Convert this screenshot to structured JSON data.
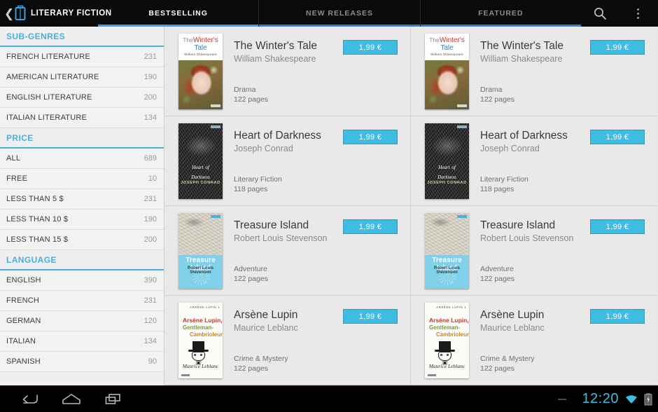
{
  "actionbar": {
    "back_icon": "back-chevron-icon",
    "app_icon": "book-reader-icon",
    "app_title": "LITERARY FICTION",
    "search_icon": "search-icon",
    "overflow_icon": "overflow-menu-icon",
    "tabs": [
      {
        "label": "BESTSELLING",
        "active": true
      },
      {
        "label": "NEW RELEASES",
        "active": false
      },
      {
        "label": "FEATURED",
        "active": false
      }
    ]
  },
  "sidebar": {
    "sections": [
      {
        "heading": "SUB-GENRES",
        "items": [
          {
            "label": "FRENCH LITERATURE",
            "count": "231"
          },
          {
            "label": "AMERICAN LITERATURE",
            "count": "190"
          },
          {
            "label": "ENGLISH LITERATURE",
            "count": "200"
          },
          {
            "label": "ITALIAN LITERATURE",
            "count": "134"
          }
        ]
      },
      {
        "heading": "PRICE",
        "items": [
          {
            "label": "ALL",
            "count": "689"
          },
          {
            "label": "FREE",
            "count": "10"
          },
          {
            "label": "LESS THAN 5 $",
            "count": "231"
          },
          {
            "label": "LESS THAN 10 $",
            "count": "190"
          },
          {
            "label": "LESS THAN 15 $",
            "count": "200"
          }
        ]
      },
      {
        "heading": "LANGUAGE",
        "items": [
          {
            "label": "ENGLISH",
            "count": "390"
          },
          {
            "label": "FRENCH",
            "count": "231"
          },
          {
            "label": "GERMAN",
            "count": "120"
          },
          {
            "label": "ITALIAN",
            "count": "134"
          },
          {
            "label": "SPANISH",
            "count": "90"
          }
        ]
      }
    ]
  },
  "books": [
    {
      "title": "The Winter's Tale",
      "author": "William Shakespeare",
      "genre": "Drama",
      "pages": "122 pages",
      "price": "1,99 €",
      "cover": "winters-tale",
      "cover_text": {
        "the": "The",
        "winters": "Winter's",
        "tale": "Tale",
        "author": "William Shakespeare"
      }
    },
    {
      "title": "Heart of Darkness",
      "author": "Joseph Conrad",
      "genre": "Literary Fiction",
      "pages": "118 pages",
      "price": "1,99 €",
      "cover": "heart-of-darkness",
      "cover_text": {
        "line1": "Heart",
        "of": "of",
        "line2": "Darkness",
        "author": "JOSEPH CONRAD"
      }
    },
    {
      "title": "Treasure Island",
      "author": "Robert Louis Stevenson",
      "genre": "Adventure",
      "pages": "122 pages",
      "price": "1,99 €",
      "cover": "treasure-island",
      "cover_text": {
        "title": "Treasure Island",
        "author": "Robert Louis Stevenson"
      }
    },
    {
      "title": "Arsène Lupin",
      "author": "Maurice Leblanc",
      "genre": "Crime & Mystery",
      "pages": "122 pages",
      "price": "1,99 €",
      "cover": "arsene-lupin",
      "cover_text": {
        "series": "ARSÈNE LUPIN 1",
        "line1": "Arsène Lupin,",
        "line2": "Gentleman-",
        "line3": "Cambrioleur",
        "author": "Maurice Leblanc"
      }
    }
  ],
  "navbar": {
    "back_icon": "back-arrow-icon",
    "home_icon": "home-icon",
    "recents_icon": "recent-apps-icon",
    "clock": "12:20",
    "wifi_icon": "wifi-icon",
    "battery_icon": "battery-charging-icon"
  },
  "colors": {
    "accent": "#4aaee0",
    "price_button": "#3fbde0",
    "tab_indicator": "#3b9fe8",
    "clock": "#3fbde0"
  }
}
